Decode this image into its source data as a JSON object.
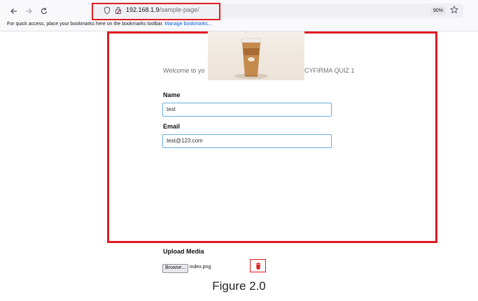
{
  "browser": {
    "url_host": "192.168.1.9",
    "url_path": "/sample-page/",
    "zoom": "90%",
    "bookmarks_message": "For quick access, place your bookmarks here on the bookmarks toolbar.",
    "bookmarks_link": "Manage bookmarks..."
  },
  "page": {
    "welcome_left": "Welcome to yo",
    "welcome_right": "CYFIRMA QUIZ 1",
    "name_label": "Name",
    "name_value": "test",
    "email_label": "Email",
    "email_value": "test@123.com",
    "upload_label": "Upload Media",
    "browse_label": "Browse...",
    "file_name": "index.png"
  },
  "caption": "Figure 2.0",
  "colors": {
    "highlight": "#e11b22",
    "field_border": "#6ab0de"
  }
}
